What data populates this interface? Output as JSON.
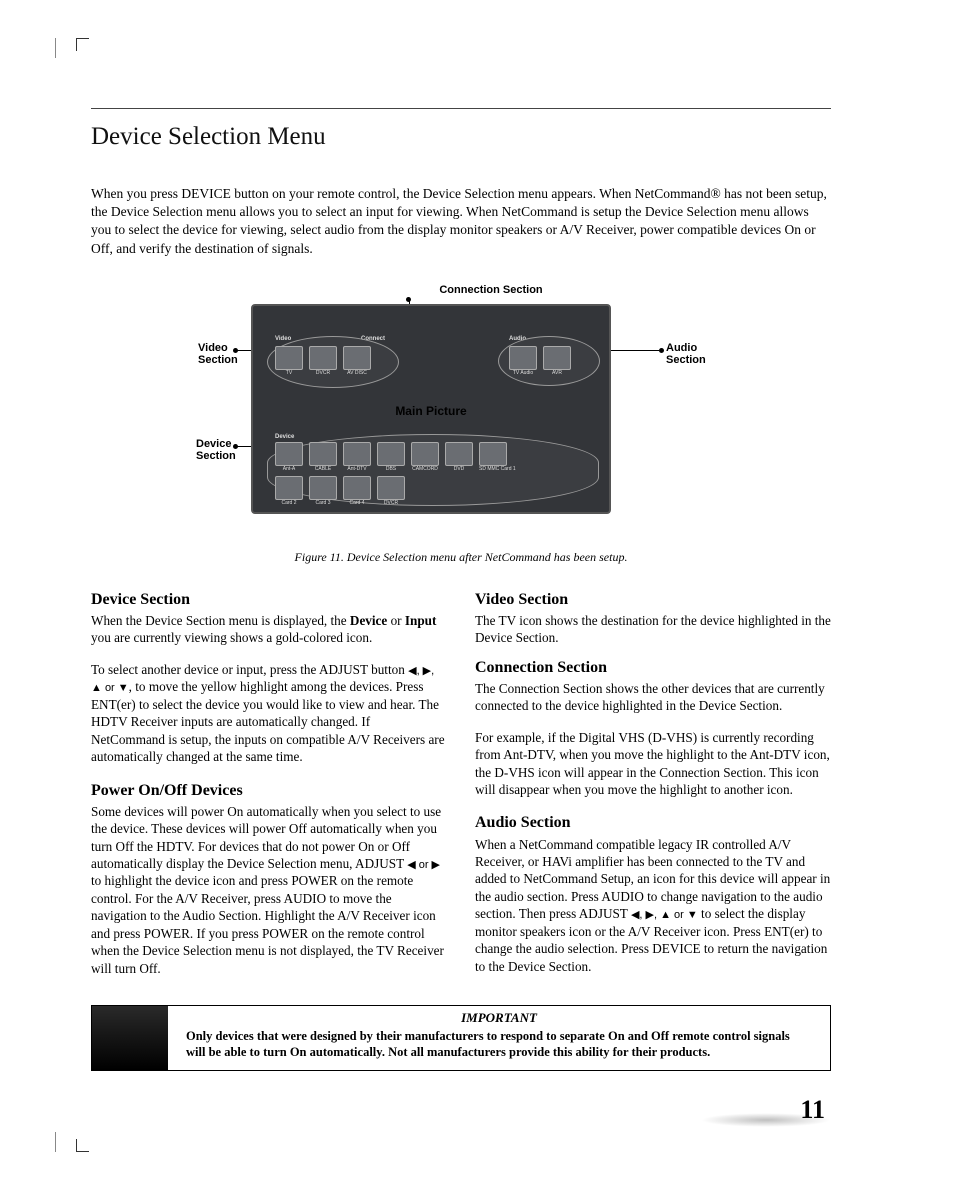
{
  "title": "Device Selection Menu",
  "intro": "When you press DEVICE button on your remote control, the Device Selection menu appears.  When NetCommand® has not been setup, the Device Selection menu allows you to select an input for viewing.  When NetCommand is setup the Device Selection menu allows you to select the device for viewing, select audio from the display monitor speakers or A/V Receiver, power compatible devices On or Off, and verify the destination of signals.",
  "figure": {
    "labels": {
      "connection": "Connection Section",
      "video": "Video Section",
      "audio": "Audio Section",
      "device": "Device Section",
      "main_picture": "Main Picture"
    },
    "screen_groups": {
      "video": "Video",
      "connect": "Connect",
      "audio": "Audio",
      "device": "Device"
    },
    "screen_icons_row_video": [
      "TV",
      "DVCR",
      "AV DISC"
    ],
    "screen_icons_row_audio": [
      "TV Audio",
      "AVR"
    ],
    "screen_icons_row_dev1": [
      "Ant-A",
      "CABLE",
      "Ant-DTV",
      "DBS",
      "CAMCORD",
      "DVD",
      "SD MMC Card 1"
    ],
    "screen_icons_row_dev2": [
      "Card 2",
      "Card 3",
      "Card 4",
      "DVCR"
    ],
    "caption": "Figure 11. Device Selection menu after NetCommand has been setup."
  },
  "left": {
    "h_device": "Device Section",
    "device_p1a": "When the Device Section menu is displayed, the ",
    "device_bold1": "Device",
    "device_p1b": " or ",
    "device_bold2": "Input",
    "device_p1c": " you are currently viewing shows a gold-colored icon.",
    "device_p2a": "To select another device or input, press the ADJUST button ",
    "device_p2b": ", to move the yellow highlight among the devices.  Press ENT(er) to select the device you would like to view and hear.  The HDTV Receiver inputs are automatically changed.  If NetCommand is setup, the inputs on compatible A/V Receivers are automatically changed at the same time.",
    "h_power": "Power On/Off Devices",
    "power_p_a": "Some devices will power On automatically when you select to use the device.  These devices will power Off automatically when you turn Off the HDTV.  For devices that do not power On or Off automatically display the Device Selection menu, ADJUST ",
    "power_p_b": " to highlight the device icon and press POWER on the remote control.  For the A/V Receiver, press AUDIO to move the navigation to the Audio Section.  Highlight the A/V Receiver icon and press POWER.  If you press POWER on the remote control when the Device Selection menu is not displayed, the TV Receiver will turn Off."
  },
  "right": {
    "h_video": "Video Section",
    "video_p": "The TV icon shows the destination for the device highlighted in the Device Section.",
    "h_conn": "Connection Section",
    "conn_p1": "The Connection Section shows the other devices that are currently connected to the device highlighted in the Device Section.",
    "conn_p2": "For example, if the Digital VHS (D-VHS) is currently recording from Ant-DTV, when you move the highlight to the Ant-DTV icon, the D-VHS icon will appear in the Connection Section.  This icon will disappear when you move the highlight to another icon.",
    "h_audio": "Audio Section",
    "audio_p_a": "When a NetCommand compatible legacy IR controlled A/V Receiver, or HAVi amplifier has been connected to the TV and added to NetCommand Setup, an icon for this device will appear in the audio section.  Press AUDIO  to change navigation to the audio section.  Then press ADJUST ",
    "audio_p_b": " to select the display monitor speakers icon or the A/V Receiver icon.  Press ENT(er) to change the audio selection.  Press DEVICE to return the navigation to the Device Section."
  },
  "arrows4": "◀, ▶, ▲ or ▼",
  "arrows2": "◀ or ▶",
  "important": {
    "title": "IMPORTANT",
    "text": "Only devices that were designed by their manufacturers to respond to separate On and Off remote control signals will be able to turn On automatically.  Not all manufacturers provide this ability for their products."
  },
  "page_number": "11"
}
